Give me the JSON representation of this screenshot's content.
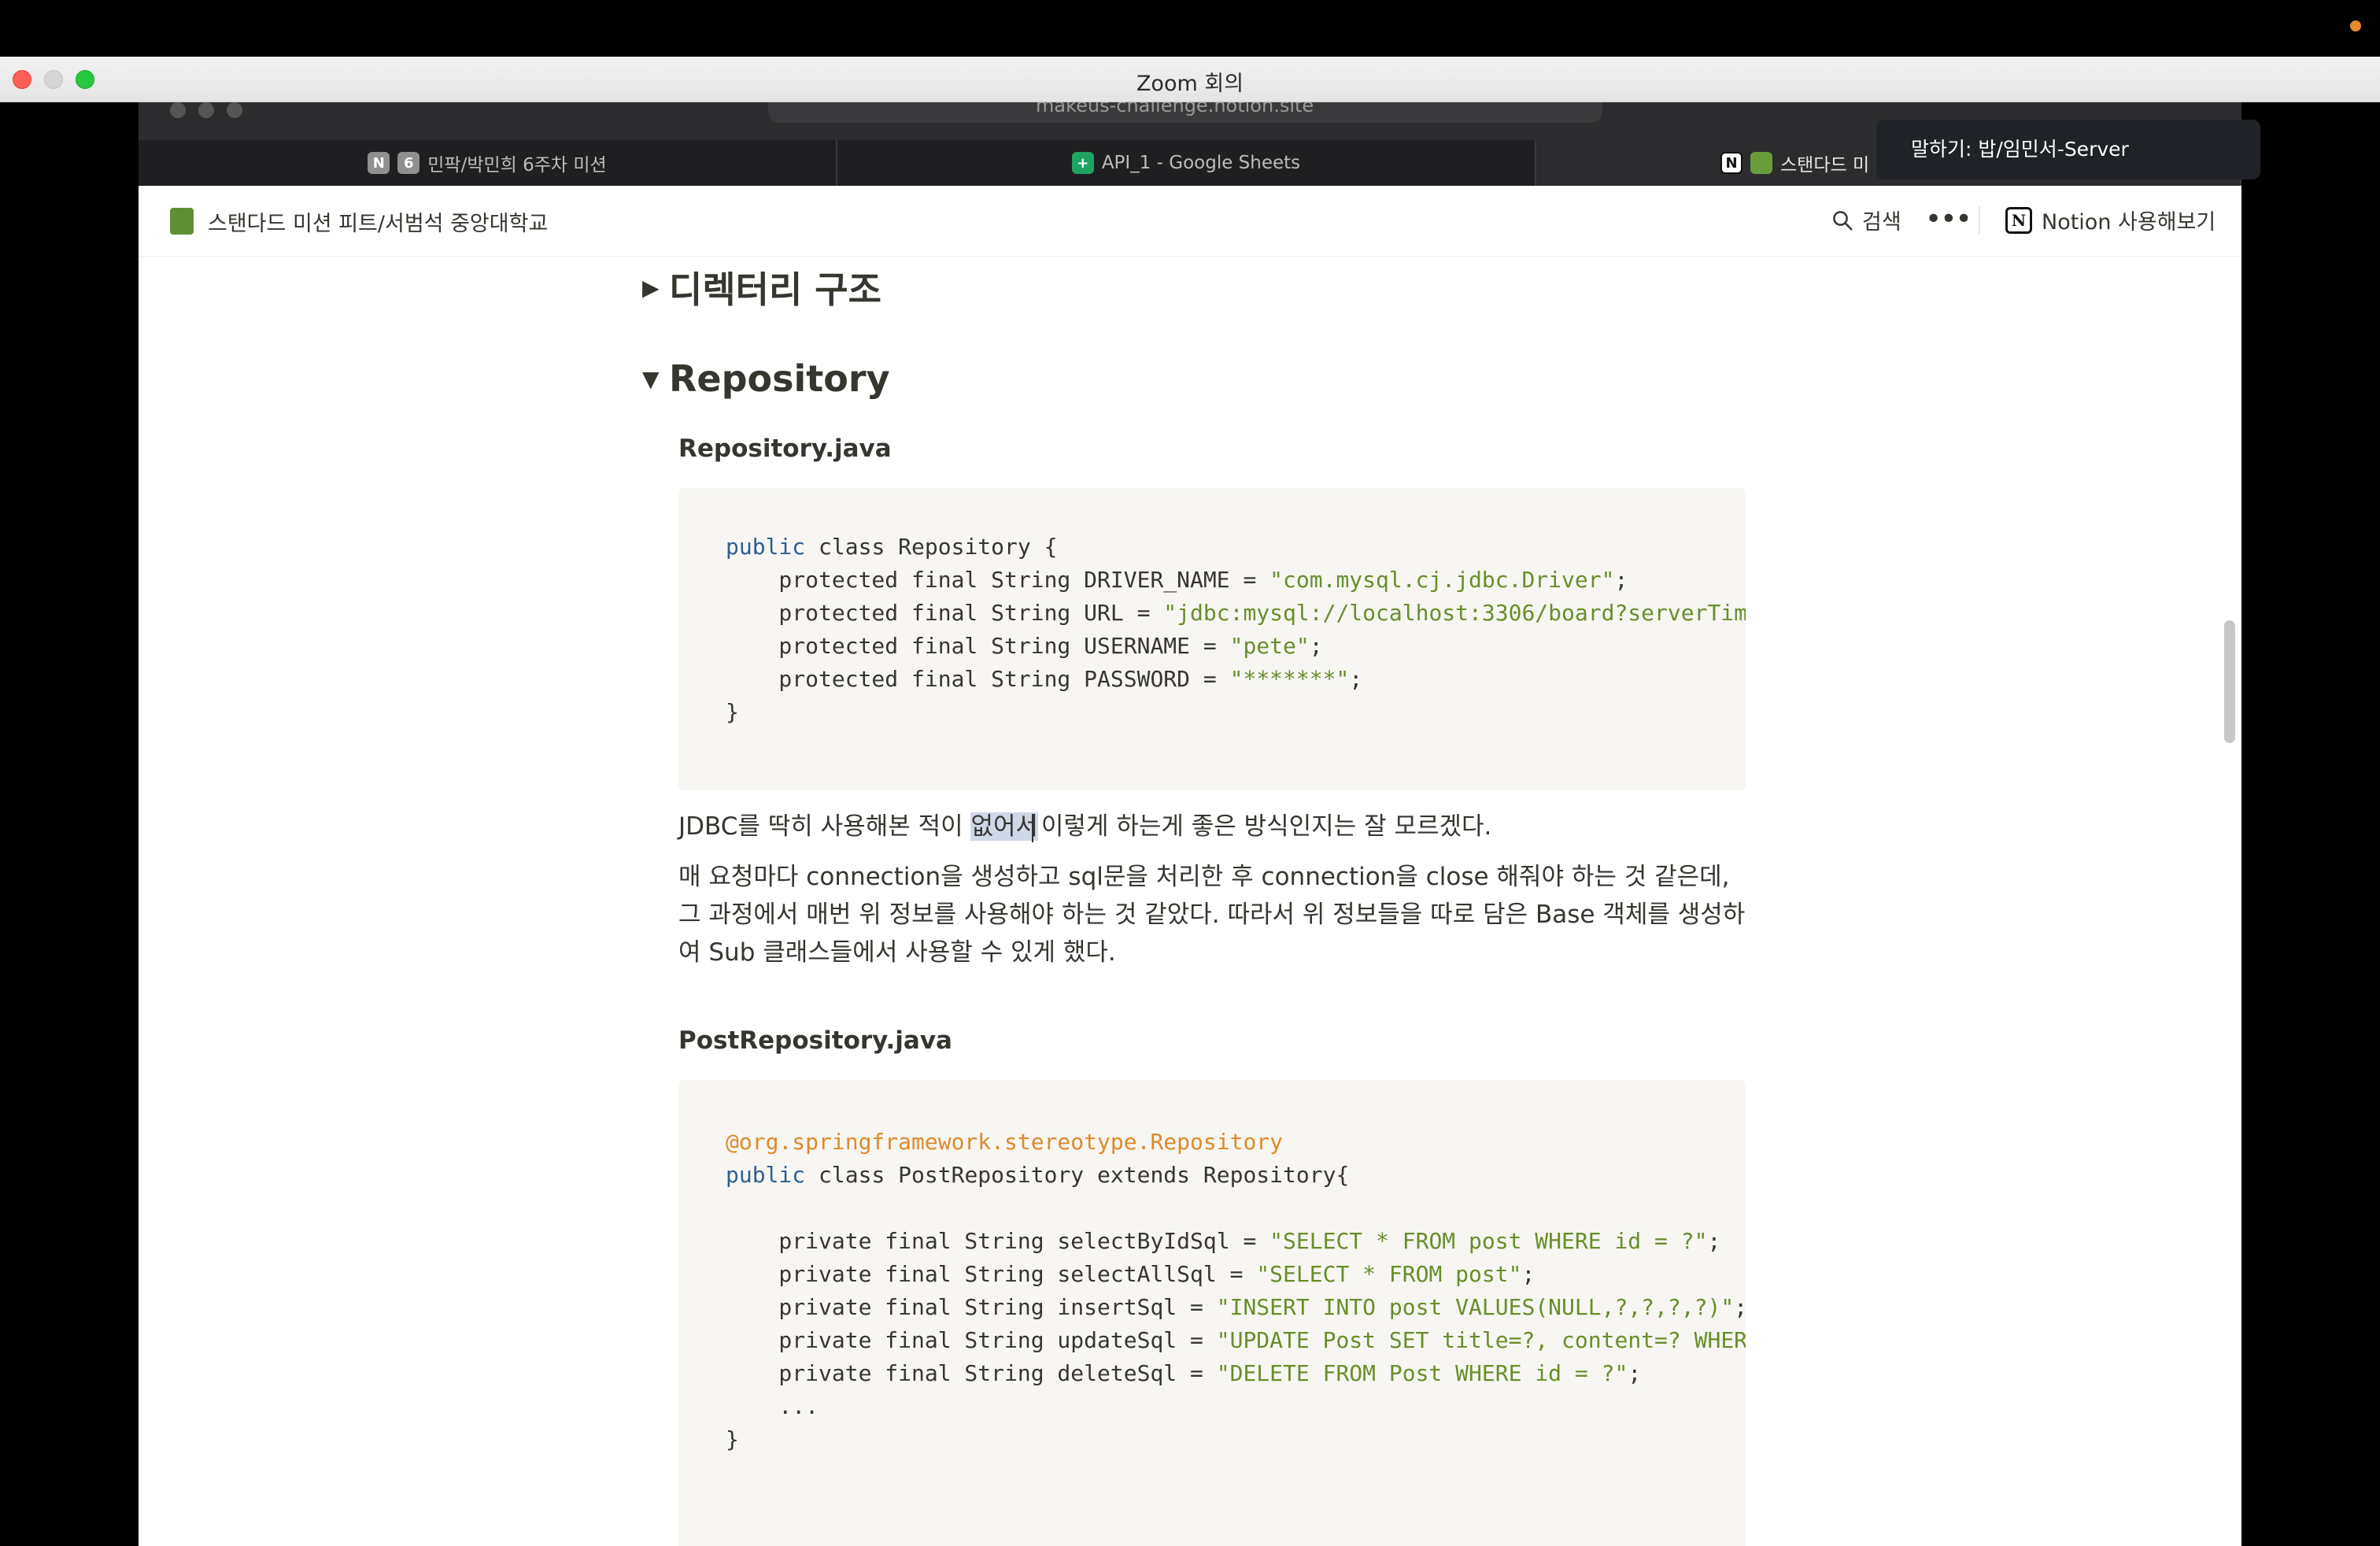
{
  "zoom": {
    "window_title": "Zoom 회의",
    "speaking_label": "말하기: 밥/임민서-Server"
  },
  "browser": {
    "url": "makeus-challenge.notion.site",
    "tabs": [
      {
        "label": "민팍/박민희 6주차 미션",
        "icon": "notion-icon",
        "active": false
      },
      {
        "label": "API_1 - Google Sheets",
        "icon": "sheets-icon",
        "active": false
      },
      {
        "label": "스탠다드 미",
        "icon": "notion-icon",
        "active": true
      }
    ]
  },
  "notion_header": {
    "page_title": "스탠다드 미션 피트/서범석 중앙대학교",
    "search_label": "검색",
    "more_label": "•••",
    "try_notion_label": "Notion 사용해보기"
  },
  "sections": {
    "directory_heading": "디렉터리 구조",
    "repository_heading": "Repository"
  },
  "repository_file": {
    "title": "Repository.java",
    "lines": {
      "l1_kw": "public",
      "l1_rest": " class Repository {",
      "l2_pre": "    protected final String DRIVER_NAME = ",
      "l2_str": "\"com.mysql.cj.jdbc.Driver\"",
      "l2_end": ";",
      "l3_pre": "    protected final String URL = ",
      "l3_str": "\"jdbc:mysql://localhost:3306/board?serverTim",
      "l4_pre": "    protected final String USERNAME = ",
      "l4_str": "\"pete\"",
      "l4_end": ";",
      "l5_pre": "    protected final String PASSWORD = ",
      "l5_str": "\"*******\"",
      "l5_end": ";",
      "l6": "}"
    }
  },
  "paragraphs": {
    "p1_before": "JDBC를 딱히 사용해본 적이 ",
    "p1_highlight": "없어서",
    "p1_after": " 이렇게 하는게 좋은 방식인지는 잘 모르겠다.",
    "p2": "매 요청마다 connection을 생성하고 sql문을 처리한 후 connection을 close 해줘야 하는 것 같은데, 그 과정에서 매번 위 정보를 사용해야 하는 것 같았다. 따라서 위 정보들을 따로 담은 Base 객체를 생성하여 Sub 클래스들에서 사용할 수 있게 했다."
  },
  "post_repository_file": {
    "title": "PostRepository.java",
    "lines": {
      "annotation": "@org.springframework.stereotype.Repository",
      "l2_kw": "public",
      "l2_rest": " class PostRepository extends Repository{",
      "l3_pre": "    private final String selectByIdSql = ",
      "l3_str": "\"SELECT * FROM post WHERE id = ?\"",
      "l3_end": ";",
      "l4_pre": "    private final String selectAllSql = ",
      "l4_str": "\"SELECT * FROM post\"",
      "l4_end": ";",
      "l5_pre": "    private final String insertSql = ",
      "l5_str": "\"INSERT INTO post VALUES(NULL,?,?,?,?)\"",
      "l5_end": ";",
      "l6_pre": "    private final String updateSql = ",
      "l6_str": "\"UPDATE Post SET title=?, content=? WHER",
      "l7_pre": "    private final String deleteSql = ",
      "l7_str": "\"DELETE FROM Post WHERE id = ?\"",
      "l7_end": ";",
      "l8": "    ...",
      "l9": "}"
    }
  },
  "colors": {
    "code_keyword": "#2f5f8f",
    "code_string": "#688e2a",
    "code_annotation": "#dd8a2a",
    "code_bg": "#f7f6f3",
    "text": "#37352f"
  }
}
